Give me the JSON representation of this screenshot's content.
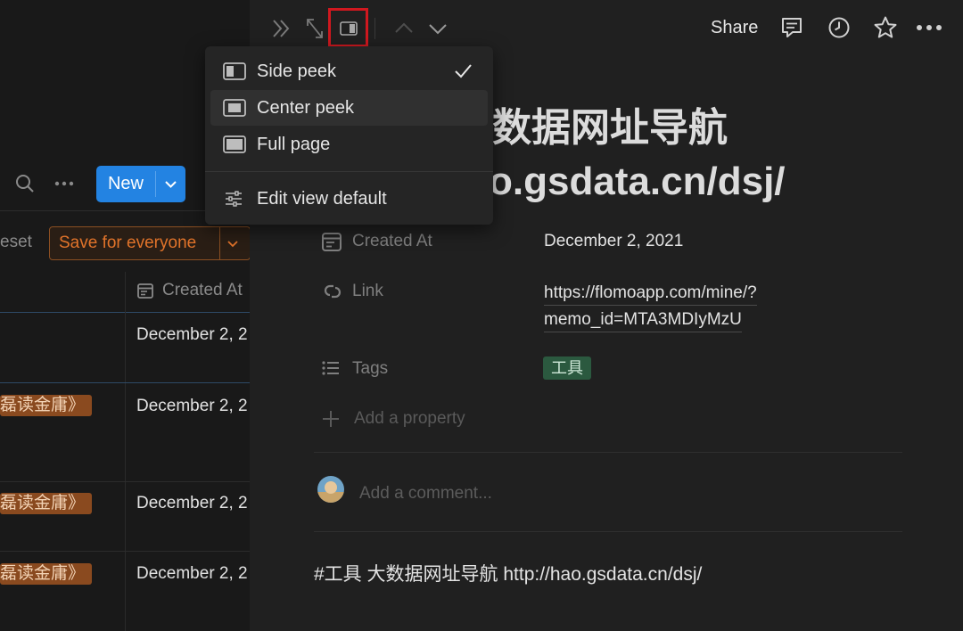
{
  "left_panel": {
    "new_button": "New",
    "reset_fragment": "eset",
    "save_button": "Save for everyone",
    "column_header": "Created At",
    "rows": [
      {
        "tag": "磊读金庸》",
        "date": "December 2, 2"
      },
      {
        "tag": "磊读金庸》",
        "date": "December 2, 2"
      },
      {
        "tag": "磊读金庸》",
        "date": "December 2, 2"
      },
      {
        "date": "December 2, 2"
      }
    ]
  },
  "topbar": {
    "share": "Share"
  },
  "page": {
    "title_line1": "数据网址导航",
    "title_line2": "o.gsdata.cn/dsj/",
    "properties": [
      {
        "label": "Created At",
        "value": "December 2, 2021"
      },
      {
        "label": "Link",
        "value_line1": "https://flomoapp.com/mine/?",
        "value_line2": "memo_id=MTA3MDIyMzU"
      },
      {
        "label": "Tags",
        "value": "工具"
      }
    ],
    "add_property": "Add a property",
    "comment_placeholder": "Add a comment...",
    "body_text": "#工具 大数据网址导航 http://hao.gsdata.cn/dsj/"
  },
  "menu": {
    "items": [
      {
        "label": "Side peek",
        "checked": true
      },
      {
        "label": "Center peek",
        "checked": false
      },
      {
        "label": "Full page",
        "checked": false
      }
    ],
    "edit_default": "Edit view default"
  },
  "colors": {
    "accent_blue": "#2383e2",
    "highlight_red": "#d0181f",
    "tag_green": "#2b593f",
    "save_orange": "#e0732a"
  }
}
